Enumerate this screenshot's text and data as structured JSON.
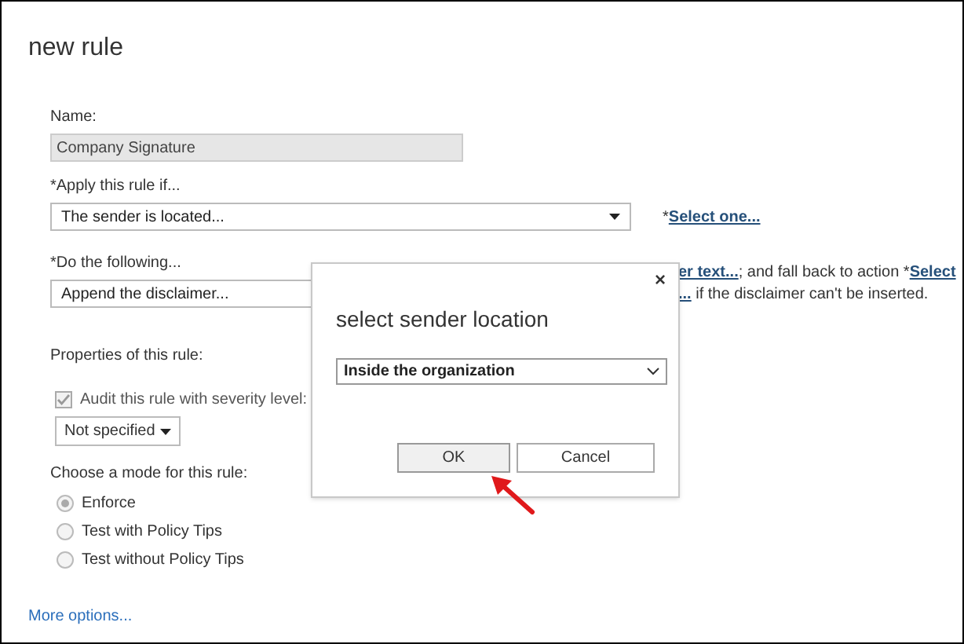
{
  "window": {
    "title": "new rule"
  },
  "form": {
    "name": {
      "label": "Name:",
      "value": "Company Signature",
      "disabled": true
    },
    "condition": {
      "label": "*Apply this rule if...",
      "value": "The sender is located...",
      "hint_prefix": "*",
      "hint_link": "Select one..."
    },
    "action": {
      "label": "*Do the following...",
      "value": "Append the disclaimer...",
      "hint_link_1": "er text...",
      "hint_text_1": "; and fall back to action *",
      "hint_link_2": "Select",
      "hint_link_3": "...",
      "hint_text_2": " if the disclaimer can't be inserted."
    },
    "properties": {
      "label": "Properties of this rule:",
      "audit": {
        "label": "Audit this rule with severity level:",
        "checked": true,
        "disabled": true
      },
      "severity": "Not specified"
    },
    "mode": {
      "label": "Choose a mode for this rule:",
      "options": [
        {
          "label": "Enforce",
          "selected": true
        },
        {
          "label": "Test with Policy Tips",
          "selected": false
        },
        {
          "label": "Test without Policy Tips",
          "selected": false
        }
      ],
      "disabled": true
    },
    "more_options": "More options..."
  },
  "dialog": {
    "title": "select sender location",
    "close": "×",
    "location": "Inside the organization",
    "buttons": [
      {
        "label": "OK",
        "focused": true
      },
      {
        "label": "Cancel",
        "focused": false
      }
    ]
  }
}
